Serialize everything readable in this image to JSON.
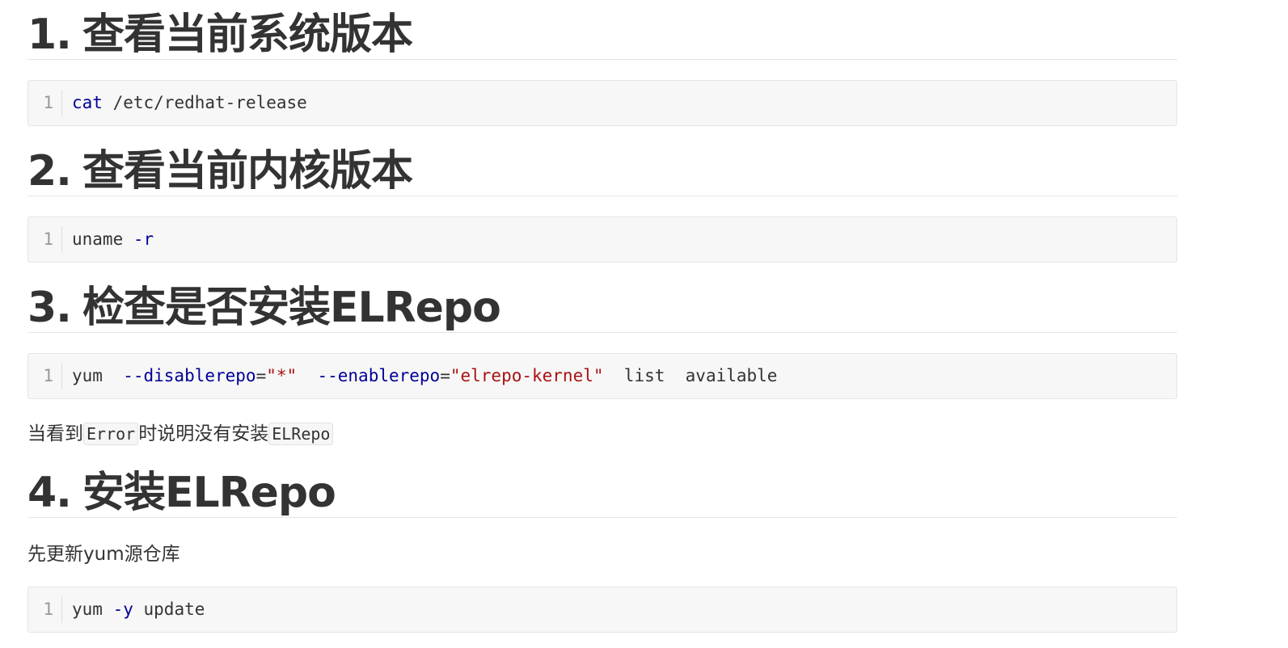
{
  "sections": [
    {
      "number": "1.",
      "title": "查看当前系统版本",
      "code": {
        "line_number": "1",
        "tokens": [
          {
            "text": "cat",
            "kind": "kw"
          },
          {
            "text": " /etc/redhat-release",
            "kind": "plain"
          }
        ]
      }
    },
    {
      "number": "2.",
      "title": "查看当前内核版本",
      "code": {
        "line_number": "1",
        "tokens": [
          {
            "text": "uname ",
            "kind": "plain"
          },
          {
            "text": "-r",
            "kind": "kw"
          }
        ]
      }
    },
    {
      "number": "3.",
      "title": "检查是否安装ELRepo",
      "code": {
        "line_number": "1",
        "tokens": [
          {
            "text": "yum  ",
            "kind": "plain"
          },
          {
            "text": "--disablerepo",
            "kind": "kw"
          },
          {
            "text": "=",
            "kind": "op"
          },
          {
            "text": "\"*\"",
            "kind": "str"
          },
          {
            "text": "  ",
            "kind": "plain"
          },
          {
            "text": "--enablerepo",
            "kind": "kw"
          },
          {
            "text": "=",
            "kind": "op"
          },
          {
            "text": "\"elrepo-kernel\"",
            "kind": "str"
          },
          {
            "text": "  list  available",
            "kind": "plain"
          }
        ]
      },
      "note": {
        "before": "当看到",
        "code1": "Error",
        "middle": "时说明没有安装",
        "code2": "ELRepo"
      }
    },
    {
      "number": "4.",
      "title": "安装ELRepo",
      "intro": "先更新yum源仓库",
      "code": {
        "line_number": "1",
        "tokens": [
          {
            "text": "yum ",
            "kind": "plain"
          },
          {
            "text": "-y",
            "kind": "kw"
          },
          {
            "text": " update",
            "kind": "plain"
          }
        ]
      }
    }
  ],
  "colors": {
    "keyword": "#000099",
    "string": "#aa1111",
    "text": "#333333",
    "code_background": "#f7f7f7",
    "line_number": "#999999"
  }
}
